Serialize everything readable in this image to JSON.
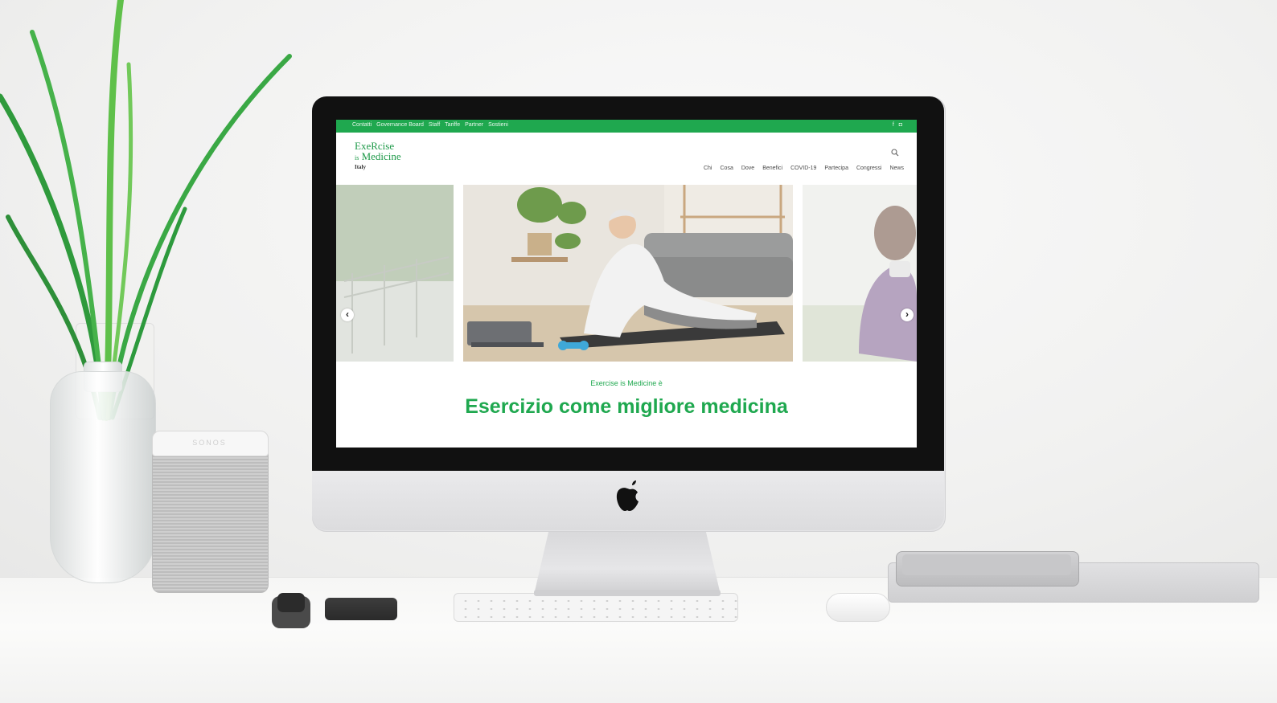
{
  "colors": {
    "brand_green": "#1fa84f",
    "text_dark": "#4a4a4a"
  },
  "topbar": {
    "links": [
      "Contatti",
      "Governance Board",
      "Staff",
      "Tariffe",
      "Partner",
      "Sostieni"
    ],
    "social": [
      {
        "icon": "facebook-icon",
        "glyph": "f"
      },
      {
        "icon": "instagram-icon",
        "glyph": "◘"
      }
    ]
  },
  "logo": {
    "line1": "ExeRcise",
    "line2_small": "is",
    "line2": "Medicine",
    "line3": "Italy"
  },
  "header": {
    "search_icon": "search-icon",
    "nav": [
      "Chi",
      "Cosa",
      "Dove",
      "Benefici",
      "COVID-19",
      "Partecipa",
      "Congressi",
      "News"
    ]
  },
  "slider": {
    "prev_glyph": "‹",
    "next_glyph": "›"
  },
  "hero": {
    "kicker": "Exercise is Medicine è",
    "headline": "Esercizio come migliore medicina"
  }
}
